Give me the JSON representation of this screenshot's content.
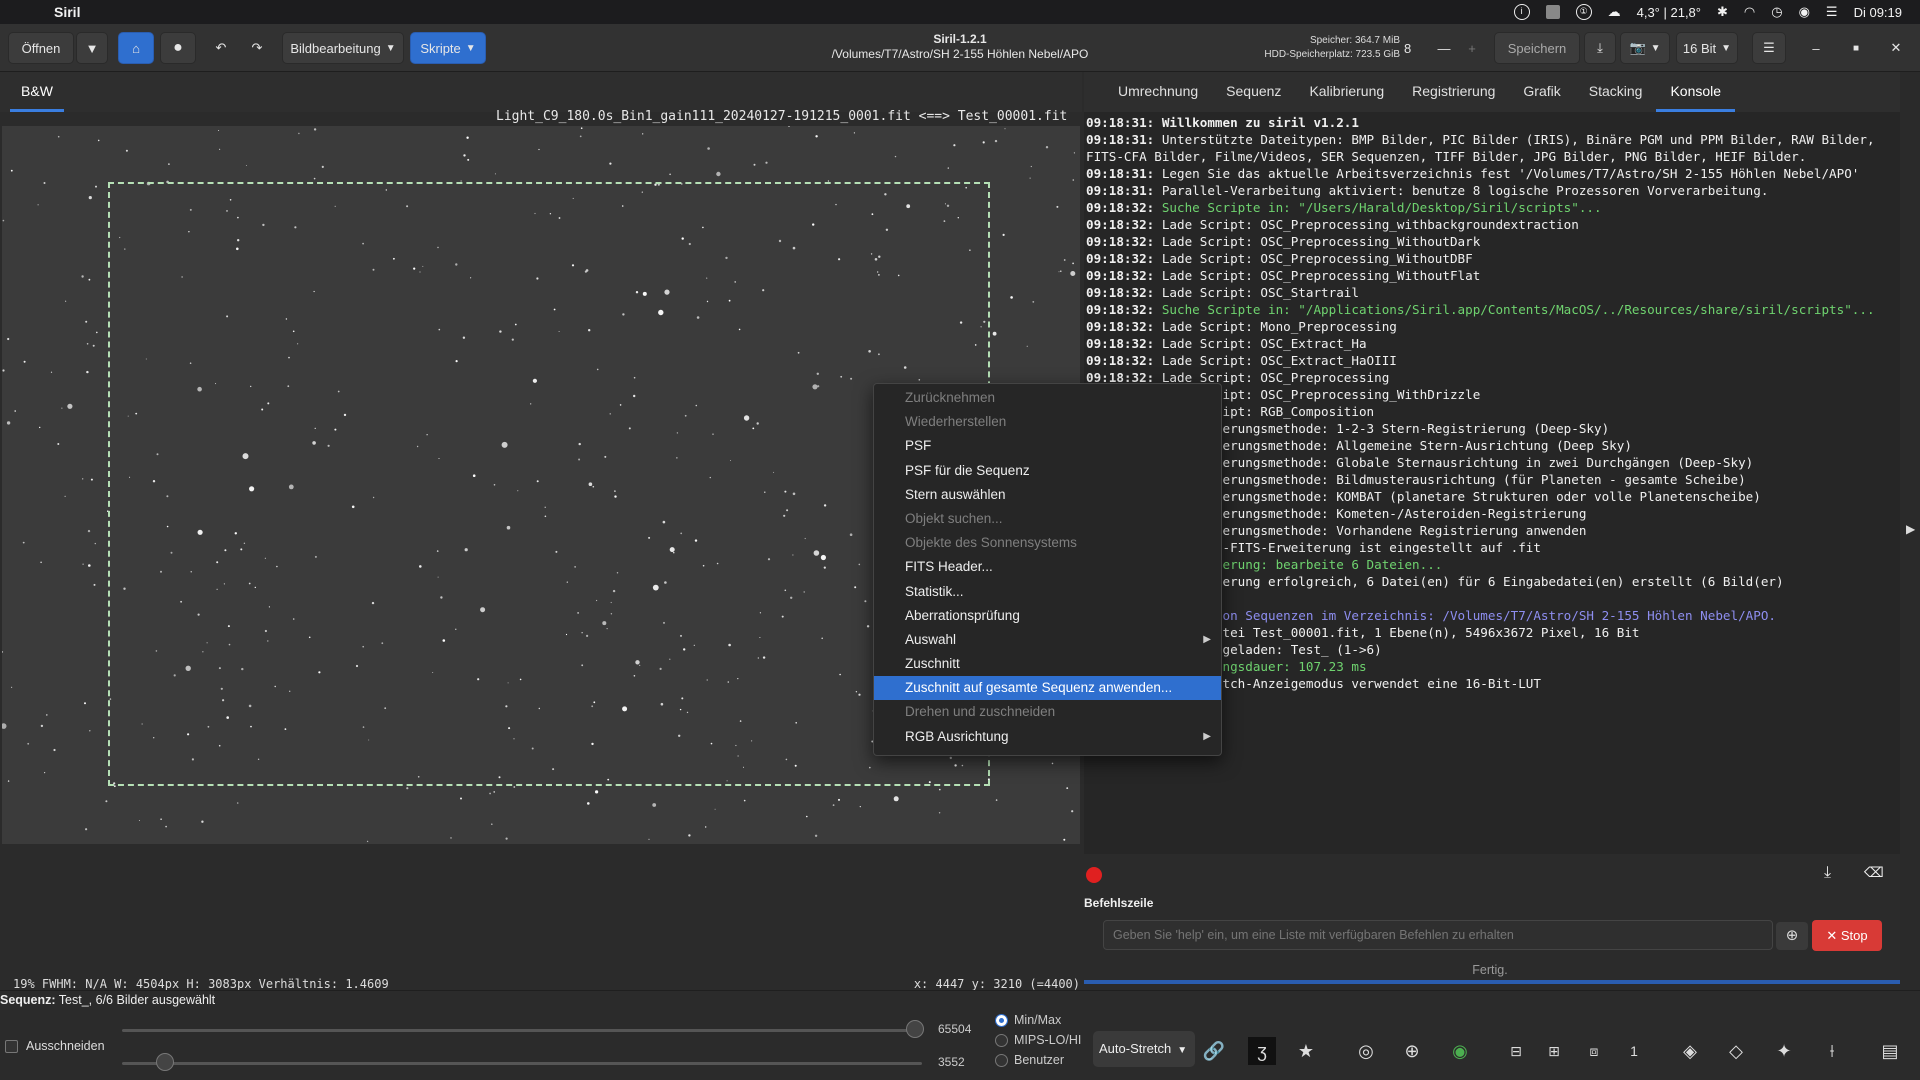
{
  "menubar": {
    "app": "Siril",
    "weather": "4,3° | 21,8°",
    "clock": "Di 09:19"
  },
  "toolbar": {
    "open_label": "Öffnen",
    "imageproc_label": "Bildbearbeitung",
    "scripts_label": "Skripte",
    "window_title": "Siril-1.2.1",
    "window_path": "/Volumes/T7/Astro/SH 2-155 Höhlen Nebel/APO",
    "memory": "Speicher: 364.7 MiB",
    "disk": "HDD-Speicherplatz: 723.5 GiB",
    "threads": "8",
    "save_label": "Speichern",
    "bitdepth_label": "16 Bit"
  },
  "image": {
    "tab_label": "B&W",
    "title": "Light_C9_180.0s_Bin1_gain111_20240127-191215_0001.fit <==> Test_00001.fit",
    "status_left": "19%   FWHM: N/A   W: 4504px H: 3083px Verhältnis: 1.4609",
    "status_right": "x: 4447 y: 3210 (=4400)"
  },
  "right_tabs": [
    "Umrechnung",
    "Sequenz",
    "Kalibrierung",
    "Registrierung",
    "Grafik",
    "Stacking",
    "Konsole"
  ],
  "console": {
    "lines": [
      {
        "ts": "09:18:31:",
        "msg": " Willkommen zu siril v1.2.1",
        "style": "bold"
      },
      {
        "ts": "09:18:31:",
        "msg": " Unterstützte Dateitypen: BMP Bilder, PIC Bilder (IRIS), Binäre PGM und PPM Bilder, RAW Bilder, FITS-CFA Bilder, Filme/Videos, SER Sequenzen, TIFF Bilder, JPG Bilder, PNG Bilder, HEIF Bilder.",
        "style": "normal"
      },
      {
        "ts": "09:18:31:",
        "msg": " Legen Sie das aktuelle Arbeitsverzeichnis fest '/Volumes/T7/Astro/SH 2-155 Höhlen Nebel/APO'",
        "style": "normal"
      },
      {
        "ts": "09:18:31:",
        "msg": " Parallel-Verarbeitung aktiviert: benutze 8 logische Prozessoren Vorverarbeitung.",
        "style": "normal"
      },
      {
        "ts": "09:18:32:",
        "msg": " Suche Scripte in: \"/Users/Harald/Desktop/Siril/scripts\"...",
        "style": "green"
      },
      {
        "ts": "09:18:32:",
        "msg": " Lade Script: OSC_Preprocessing_withbackgroundextraction",
        "style": "normal"
      },
      {
        "ts": "09:18:32:",
        "msg": " Lade Script: OSC_Preprocessing_WithoutDark",
        "style": "normal"
      },
      {
        "ts": "09:18:32:",
        "msg": " Lade Script: OSC_Preprocessing_WithoutDBF",
        "style": "normal"
      },
      {
        "ts": "09:18:32:",
        "msg": " Lade Script: OSC_Preprocessing_WithoutFlat",
        "style": "normal"
      },
      {
        "ts": "09:18:32:",
        "msg": " Lade Script: OSC_Startrail",
        "style": "normal"
      },
      {
        "ts": "09:18:32:",
        "msg": " Suche Scripte in: \"/Applications/Siril.app/Contents/MacOS/../Resources/share/siril/scripts\"...",
        "style": "green"
      },
      {
        "ts": "09:18:32:",
        "msg": " Lade Script: Mono_Preprocessing",
        "style": "normal"
      },
      {
        "ts": "09:18:32:",
        "msg": " Lade Script: OSC_Extract_Ha",
        "style": "normal"
      },
      {
        "ts": "09:18:32:",
        "msg": " Lade Script: OSC_Extract_HaOIII",
        "style": "normal"
      },
      {
        "ts": "09:18:32:",
        "msg": " Lade Script: OSC_Preprocessing",
        "style": "normal"
      },
      {
        "ts": "09:18:32:",
        "msg": " Lade Script: OSC_Preprocessing_WithDrizzle",
        "style": "normal"
      },
      {
        "ts": "09:18:32:",
        "msg": " Lade Script: RGB_Composition",
        "style": "normal"
      },
      {
        "ts": "09:18:32:",
        "msg": " Registrierungsmethode: 1-2-3 Stern-Registrierung (Deep-Sky)",
        "style": "normal"
      },
      {
        "ts": "09:18:32:",
        "msg": " Registrierungsmethode: Allgemeine Stern-Ausrichtung (Deep Sky)",
        "style": "normal"
      },
      {
        "ts": "09:18:32:",
        "msg": " Registrierungsmethode: Globale Sternausrichtung in zwei Durchgängen (Deep-Sky)",
        "style": "normal"
      },
      {
        "ts": "09:18:32:",
        "msg": " Registrierungsmethode: Bildmusterausrichtung (für Planeten - gesamte Scheibe)",
        "style": "normal"
      },
      {
        "ts": "09:18:32:",
        "msg": " Registrierungsmethode: KOMBAT (planetare Strukturen oder volle Planetenscheibe)",
        "style": "normal"
      },
      {
        "ts": "09:18:32:",
        "msg": " Registrierungsmethode: Kometen-/Asteroiden-Registrierung",
        "style": "normal"
      },
      {
        "ts": "09:18:32:",
        "msg": " Registrierungsmethode: Vorhandene Registrierung anwenden",
        "style": "normal"
      },
      {
        "ts": "09:18:32:",
        "msg": " Standard-FITS-Erweiterung ist eingestellt auf .fit",
        "style": "normal"
      },
      {
        "ts": "09:18:32:",
        "msg": " Konvertierung: bearbeite 6 Dateien...",
        "style": "green"
      },
      {
        "ts": "09:18:32:",
        "msg": " Konvertierung erfolgreich, 6 Datei(en) für 6 Eingabedatei(en) erstellt (6 Bild(er) fehlgeschlagen)",
        "style": "normal"
      },
      {
        "ts": "09:18:32:",
        "msg": " Suchen von Sequenzen im Verzeichnis: /Volumes/T7/Astro/SH 2-155 Höhlen Nebel/APO.",
        "style": "blue"
      },
      {
        "ts": "09:18:32:",
        "msg": " FITS: Datei Test_00001.fit, 1 Ebene(n), 5496x3672 Pixel, 16 Bit",
        "style": "normal"
      },
      {
        "ts": "09:18:32:",
        "msg": " Sequenz geladen: Test_ (1->6)",
        "style": "normal"
      },
      {
        "ts": "09:18:32:",
        "msg": " Ausführungsdauer: 107.23 ms",
        "style": "green"
      },
      {
        "ts": "09:18:32:",
        "msg": " AutoStretch-Anzeigemodus verwendet eine 16-Bit-LUT",
        "style": "normal"
      }
    ],
    "command_label": "Befehlszeile",
    "command_placeholder": "Geben Sie 'help' ein, um eine Liste mit verfügbaren Befehlen zu erhalten",
    "stop_label": "Stop",
    "status": "Fertig."
  },
  "context_menu": [
    {
      "label": "Zurücknehmen",
      "disabled": true
    },
    {
      "label": "Wiederherstellen",
      "disabled": true
    },
    {
      "label": "PSF",
      "disabled": false
    },
    {
      "label": "PSF für die Sequenz",
      "disabled": false
    },
    {
      "label": "Stern auswählen",
      "disabled": false
    },
    {
      "label": "Objekt suchen...",
      "disabled": true
    },
    {
      "label": "Objekte des Sonnensystems",
      "disabled": true
    },
    {
      "label": "FITS Header...",
      "disabled": false
    },
    {
      "label": "Statistik...",
      "disabled": false
    },
    {
      "label": "Aberrationsprüfung",
      "disabled": false
    },
    {
      "label": "Auswahl",
      "disabled": false,
      "submenu": true
    },
    {
      "label": "Zuschnitt",
      "disabled": false
    },
    {
      "label": "Zuschnitt auf gesamte Sequenz anwenden...",
      "disabled": false,
      "selected": true
    },
    {
      "label": "Drehen und zuschneiden",
      "disabled": true
    },
    {
      "label": "RGB Ausrichtung",
      "disabled": false,
      "submenu": true
    }
  ],
  "bottom": {
    "sequence_label": "Sequenz:",
    "sequence_text": " Test_, 6/6 Bilder ausgewählt",
    "cut_label": "Ausschneiden",
    "high_value": "65504",
    "low_value": "3552",
    "radio_options": [
      "Min/Max",
      "MIPS-LO/HI",
      "Benutzer"
    ],
    "radio_selected": "Min/Max",
    "stretch_label": "Auto-Stretch"
  }
}
